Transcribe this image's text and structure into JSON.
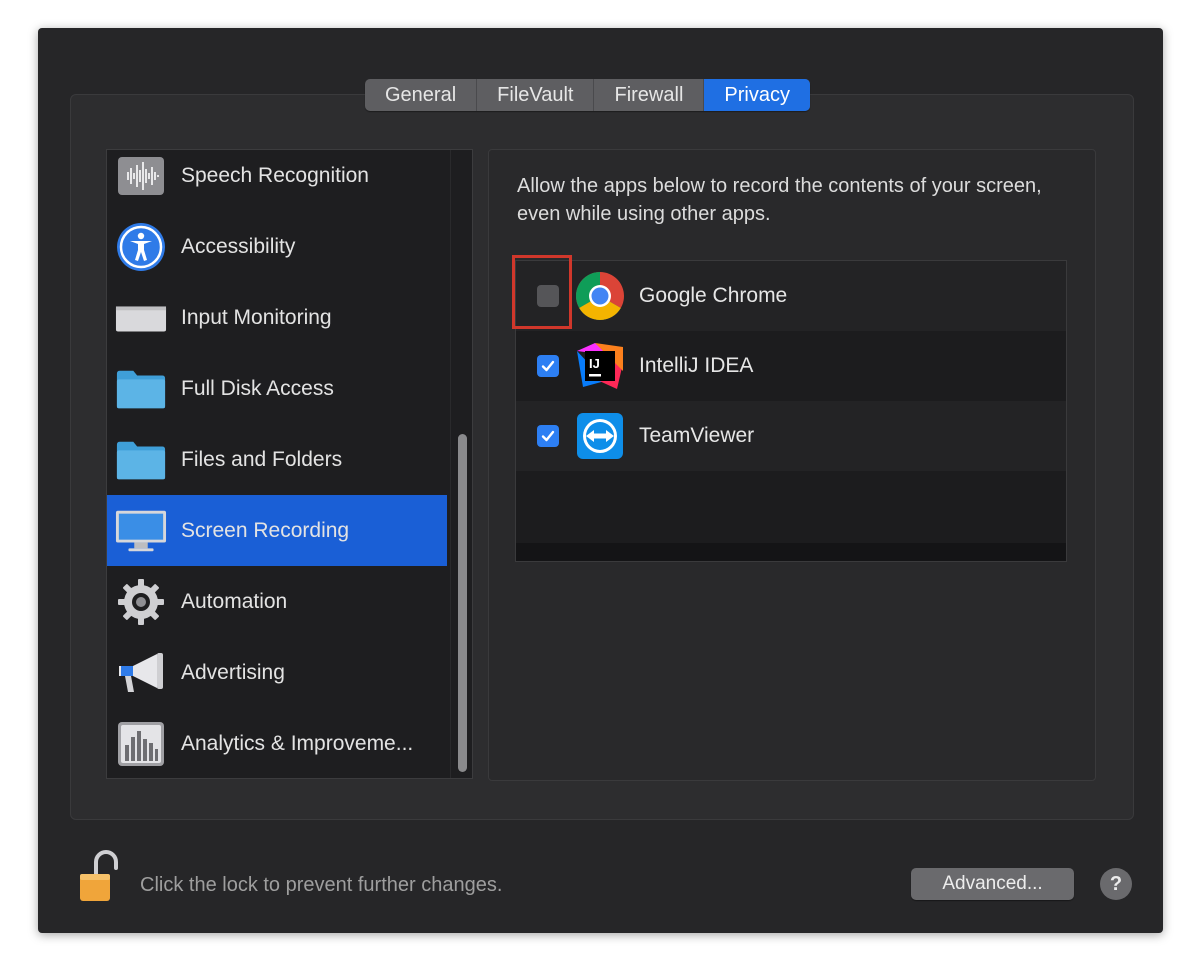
{
  "tabs": [
    {
      "label": "General",
      "active": false
    },
    {
      "label": "FileVault",
      "active": false
    },
    {
      "label": "Firewall",
      "active": false
    },
    {
      "label": "Privacy",
      "active": true
    }
  ],
  "sidebar": {
    "items": [
      {
        "label": "Speech Recognition",
        "icon": "waveform-icon"
      },
      {
        "label": "Accessibility",
        "icon": "accessibility-icon"
      },
      {
        "label": "Input Monitoring",
        "icon": "keyboard-icon"
      },
      {
        "label": "Full Disk Access",
        "icon": "folder-icon"
      },
      {
        "label": "Files and Folders",
        "icon": "folder-icon"
      },
      {
        "label": "Screen Recording",
        "icon": "display-icon",
        "selected": true
      },
      {
        "label": "Automation",
        "icon": "gear-icon"
      },
      {
        "label": "Advertising",
        "icon": "megaphone-icon"
      },
      {
        "label": "Analytics & Improveme...",
        "icon": "bar-chart-icon"
      }
    ]
  },
  "main": {
    "description": "Allow the apps below to record the contents of your screen, even while using other apps.",
    "apps": [
      {
        "name": "Google Chrome",
        "checked": false,
        "icon": "chrome-icon",
        "highlighted": true
      },
      {
        "name": "IntelliJ IDEA",
        "checked": true,
        "icon": "intellij-icon"
      },
      {
        "name": "TeamViewer",
        "checked": true,
        "icon": "teamviewer-icon"
      }
    ]
  },
  "footer": {
    "lock_text": "Click the lock to prevent further changes.",
    "advanced_label": "Advanced...",
    "help_label": "?"
  },
  "colors": {
    "accent": "#1f6fe3",
    "selection": "#1a5fd6",
    "checkbox_on": "#2d7ff3",
    "highlight": "#d0372b"
  }
}
